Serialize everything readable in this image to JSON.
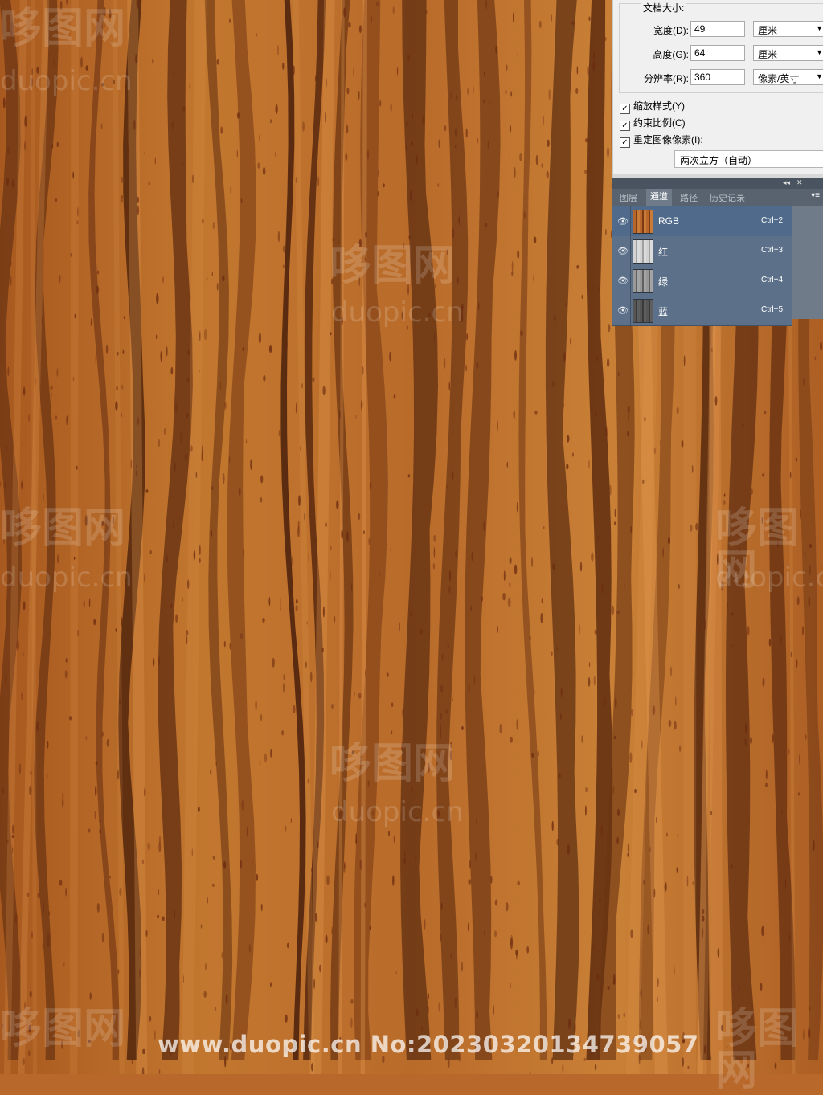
{
  "watermark": {
    "logo_text": "哆图网",
    "domain_text": "duopic.cn",
    "bottom_text": "www.duopic.cn No:20230320134739057"
  },
  "dialog": {
    "group_title": "文档大小:",
    "width_label": "宽度(D):",
    "width_value": "49",
    "width_unit": "厘米",
    "height_label": "高度(G):",
    "height_value": "64",
    "height_unit": "厘米",
    "resolution_label": "分辨率(R):",
    "resolution_value": "360",
    "resolution_unit": "像素/英寸",
    "scale_styles_label": "缩放样式(Y)",
    "constrain_label": "约束比例(C)",
    "resample_label": "重定图像像素(I):",
    "resample_method": "两次立方（自动）",
    "scale_styles_checked": true,
    "constrain_checked": true,
    "resample_checked": true
  },
  "panel": {
    "collapse_icon": "double-chevron-icon",
    "close_icon": "close-icon",
    "tabs": [
      "图层",
      "通道",
      "路径",
      "历史记录"
    ],
    "active_tab": "通道",
    "channels": [
      {
        "name": "RGB",
        "shortcut": "Ctrl+2",
        "thumb_color": "#b8662a"
      },
      {
        "name": "红",
        "shortcut": "Ctrl+3",
        "thumb_color": "#c9c9c9"
      },
      {
        "name": "绿",
        "shortcut": "Ctrl+4",
        "thumb_color": "#8e8e8e"
      },
      {
        "name": "蓝",
        "shortcut": "Ctrl+5",
        "thumb_color": "#4e4e4e"
      }
    ]
  },
  "colors": {
    "wood_base": "#b8682a",
    "wood_light": "#d88f4a",
    "wood_dark": "#5a2a10",
    "panel_bg": "#6f7b89"
  }
}
